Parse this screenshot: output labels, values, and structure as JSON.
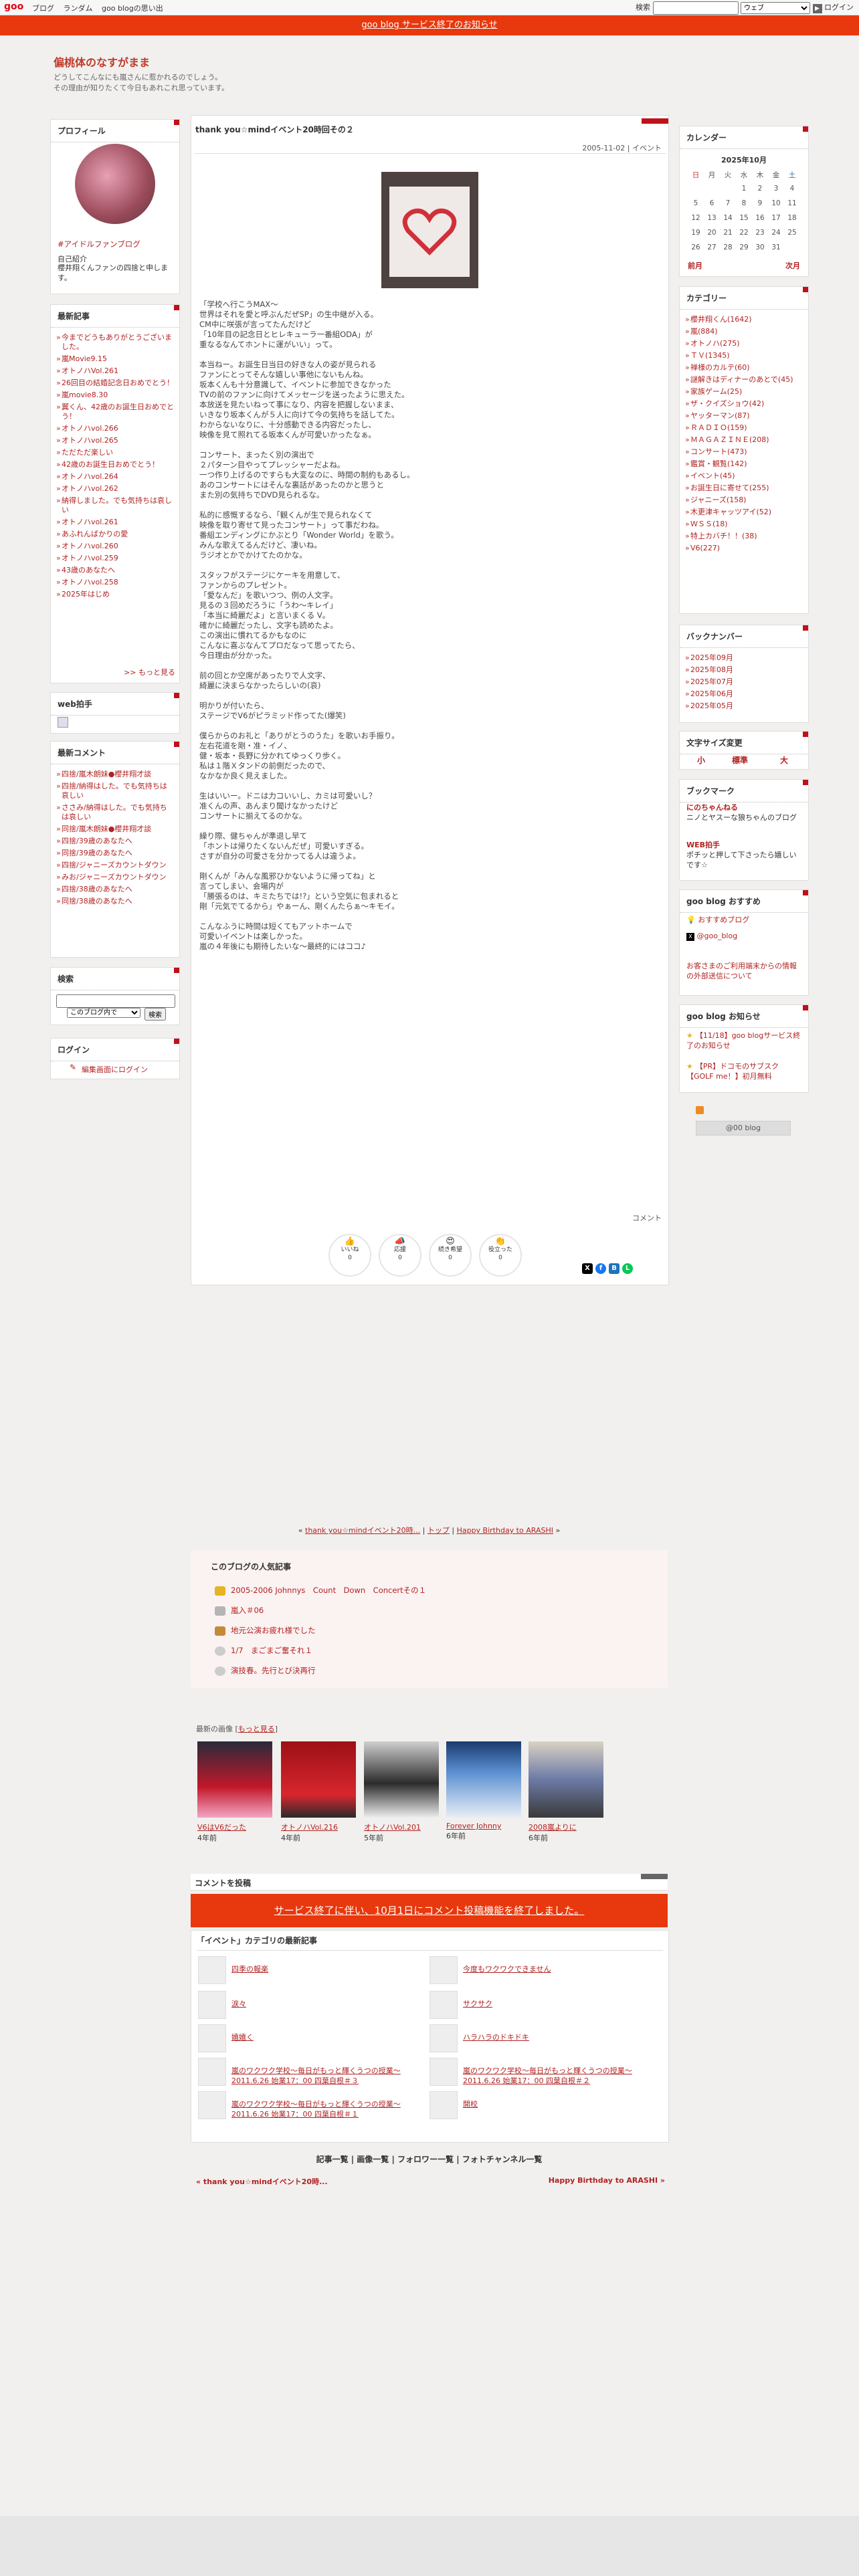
{
  "topbar": {
    "logo": "goo",
    "nav": [
      "ブログ",
      "ランダム",
      "goo blogの思い出"
    ],
    "search_label": "検索",
    "search_scope": "ウェブ",
    "login": "ログイン"
  },
  "notice": "goo blog サービス終了のお知らせ",
  "blog": {
    "title": "偏桃体のなすがまま",
    "desc1": "どうしてこんなにも嵐さんに惹かれるのでしょう。",
    "desc2": "その理由が知りたくて今日もあれこれ思っています。"
  },
  "profile": {
    "heading": "プロフィール",
    "tag": "#アイドルファンブログ",
    "intro_label": "自己紹介",
    "intro": "櫻井翔くんファンの四捨と申します。"
  },
  "recent_posts": {
    "heading": "最新記事",
    "items": [
      "今までどうもありがとうございました。",
      "嵐Movie9.15",
      "オトノハVol.261",
      "26回目の結婚記念日おめでとう！",
      "嵐movie8.30",
      "翼くん、42歳のお誕生日おめでとう！",
      "オトノハvol.266",
      "オトノハvol.265",
      "ただただ楽しい",
      "42歳のお誕生日おめでとう！",
      "オトノハvol.264",
      "オトノハvol.262",
      "納得しました。でも気持ちは哀しい",
      "オトノハvol.261",
      "あふれんばかりの愛",
      "オトノハvol.260",
      "オトノハvol.259",
      "43歳のあなたへ",
      "オトノハvol.258",
      "2025年はじめ"
    ],
    "more": ">> もっと見る"
  },
  "web_clap": {
    "heading": "web拍手"
  },
  "recent_comments": {
    "heading": "最新コメント",
    "items": [
      "四捨/嵐木朗妹●櫻井翔才談",
      "四捨/納得はした。でも気持ちは哀しい",
      "ささみ/納得はした。でも気持ちは哀しい",
      "同捨/嵐木朗妹●櫻井翔才談",
      "四捨/39歳のあなたへ",
      "同捨/39歳のあなたへ",
      "四捨/ジャニーズカウントダウン",
      "みお/ジャニーズカウントダウン",
      "四捨/38歳のあなたへ",
      "同捨/38歳のあなたへ"
    ]
  },
  "search": {
    "heading": "検索",
    "scope": "このブログ内で",
    "button": "検索"
  },
  "login_box": {
    "heading": "ログイン",
    "link": "編集画面にログイン"
  },
  "post": {
    "title": "thank you☆mindイベント20時回その２",
    "meta": "2005-11-02 | イベント",
    "paragraphs": [
      "「学校へ行こうMAX～\n世界はそれを愛と呼ぶんだぜSP」の生中継が入る。\nCM中に咲張が言ってたんだけど\n「10年目の記念日とヒレキューラ一番組ODA」が\n重なるなんてホントに運がいい」って。",
      "本当ねー。お誕生日当日の好きな人の姿が見られる\nファンにとってそんな嬉しい事他にないもんね。\n坂本くんも十分意識して、イベントに参加できなかった\nTVの前のファンに向けてメッセージを送ったように思えた。\n本放送を見たいねって事になり、内容を把握しないまま、\nいきなり坂本くんが５人に向けて今の気持ちを話してた。\nわからないなりに、十分感動できる内容だったし、\n映像を見て照れてる坂本くんが可愛いかったなぁ。",
      "コンサート、まったく別の演出で\n２パターン目やってプレッシャーだよね。\n一つ作り上げるのですらも大変なのに、時間の制約もあるし。\nあのコンサートにはそんな裏話があったのかと思うと\nまた別の気持ちでDVD見られるな。",
      "私的に感慨するなら、「観くんが生で見られなくて\n映像を取り寄せて見ったコンサート」って事だわね。\n番組エンディングにかぶとり「Wonder World」を歌う。\nみんな歌えてるんだけど、凄いね。\nラジオとかでかけてたのかな。",
      "スタッフがステージにケーキを用意して、\nファンからのプレゼント。\n「愛なんだ」を歌いつつ、例の人文字。\n見るの３回めだろうに「うわ～キレイ」\n「本当に綺麗だよ」と言いまくる V。\n確かに綺麗だったし、文字も読めたよ。\nこの演出に慣れてるかもなのに\nこんなに喜ぶなんてプロだなって思ってたら、\n今日理由が分かった。",
      "前の回とか空席があったりで人文字、\n綺麗に決まらなかったらしいの(哀)",
      "明かりが付いたら、\nステージでV6がピラミッド作ってた(爆笑)",
      "僕らからのお礼と「ありがとうのうた」を歌いお手振り。\n左右花道を剛・准・イノ、\n健・坂本・長野に分かれてゆっくり歩く。\n私は１階Ｘタンドの前側だったので、\nなかなか良く見えました。",
      "生はいいー。ドニは力コいいし、カミは可愛いし？\n准くんの声、あんまり聞けなかったけど\nコンサートに揃えてるのかな。",
      "繰り際、健ちゃんが準退し早て\n「ホントは帰りたくないんだぜ」可愛いすぎる。\nさすが自分の可愛さを分かってる人は違うよ。",
      "剛くんが「みんな風邪ひかないように帰ってね」と\n言ってしまい、会場内が\n「勝張るのは、キミたちでは!?」という空気に包まれると\n剛「元気でてるから」やぁーん、剛くんたらぁ～キモイ。",
      "こんなふうに時間は短くてもアットホームで\n可愛いイベントは楽しかった。\n嵐の４年後にも期待したいな～最終的にはココ♪"
    ],
    "comment_link": "コメント",
    "reactions": [
      {
        "label": "いいね",
        "count": "0"
      },
      {
        "label": "応援",
        "count": "0"
      },
      {
        "label": "続き希望",
        "count": "0"
      },
      {
        "label": "役立った",
        "count": "0"
      }
    ]
  },
  "pagenav": {
    "prev": "thank you☆mindイベント20時...",
    "top": "トップ",
    "next": "Happy Birthday to ARASHI"
  },
  "popular": {
    "heading": "このブログの人気記事",
    "items": [
      "2005-2006 Johnnys　Count　Down　Concertその１",
      "嵐入＃06",
      "地元公演お疲れ様でした",
      "1/7　まごまご奮それ１",
      "演技春。先行とび決再行"
    ]
  },
  "recent_images": {
    "label": "最新の画像",
    "more": "もっと見る",
    "items": [
      {
        "caption": "V6はV6だった",
        "age": "4年前"
      },
      {
        "caption": "オトノハVol.216",
        "age": "4年前"
      },
      {
        "caption": "オトノハVol.201",
        "age": "5年前"
      },
      {
        "caption": "Forever Johnny",
        "age": "6年前"
      },
      {
        "caption": "2008嵐よりに",
        "age": "6年前"
      }
    ]
  },
  "comment_section": {
    "heading": "コメントを投稿",
    "closed": "サービス終了に伴い、10月1日にコメント投稿機能を終了しました。"
  },
  "category_recent": {
    "heading": "「イベント」カテゴリの最新記事",
    "items": [
      "四季の報楽",
      "今度もワクワクできません",
      "涙々",
      "サクサク",
      "嬉嬉く",
      "ハラハラのドキドキ",
      "嵐のワクワク学校～毎日がもっと輝くうつの授業～2011.6.26 始業17：00 四葉自根＃３",
      "嵐のワクワク学校～毎日がもっと輝くうつの授業～2011.6.26 始業17：00 四葉自根＃２",
      "嵐のワクワク学校～毎日がもっと輝くうつの授業～2011.6.26 始業17：00 四葉自根＃１",
      "開校"
    ]
  },
  "footer": {
    "links": "記事一覧 | 画像一覧 | フォロワー一覧 | フォトチャンネル一覧",
    "prev": "« thank you☆mindイベント20時...",
    "next": "Happy Birthday to ARASHI »"
  },
  "calendar": {
    "heading": "カレンダー",
    "month": "2025年10月",
    "weekdays": [
      "日",
      "月",
      "火",
      "水",
      "木",
      "金",
      "土"
    ],
    "weeks": [
      [
        "",
        "",
        "",
        "1",
        "2",
        "3",
        "4"
      ],
      [
        "5",
        "6",
        "7",
        "8",
        "9",
        "10",
        "11"
      ],
      [
        "12",
        "13",
        "14",
        "15",
        "16",
        "17",
        "18"
      ],
      [
        "19",
        "20",
        "21",
        "22",
        "23",
        "24",
        "25"
      ],
      [
        "26",
        "27",
        "28",
        "29",
        "30",
        "31",
        ""
      ]
    ],
    "prev": "前月",
    "next": "次月"
  },
  "categories": {
    "heading": "カテゴリー",
    "items": [
      "櫻井翔くん(1642)",
      "嵐(884)",
      "オトノハ(275)",
      "ＴＶ(1345)",
      "禅様のカルテ(60)",
      "謎解きはディナーのあとで(45)",
      "家族ゲーム(25)",
      "ザ・クイズショウ(42)",
      "ヤッターマン(87)",
      "ＲＡＤＩＯ(159)",
      "ＭＡＧＡＺＩＮＥ(208)",
      "コンサート(473)",
      "鑑賞・観覧(142)",
      "イベント(45)",
      "お誕生日に寄せて(255)",
      "ジャニーズ(158)",
      "木更津キャッツアイ(52)",
      "ＷＳＳ(18)",
      "特上カバチ！！(38)",
      "V6(227)"
    ]
  },
  "backnumber": {
    "heading": "バックナンバー",
    "items": [
      "2025年09月",
      "2025年08月",
      "2025年07月",
      "2025年06月",
      "2025年05月"
    ]
  },
  "fontsize": {
    "heading": "文字サイズ変更",
    "small": "小",
    "normal": "標準",
    "large": "大"
  },
  "bookmark": {
    "heading": "ブックマーク",
    "items": [
      {
        "title": "にのちゃんねる",
        "desc": "ニノとヤスーな狼ちゃんのブログ"
      },
      {
        "title": "WEB拍手",
        "desc": "ポチッと押して下さったら嬉しいです☆"
      }
    ]
  },
  "goo_recommend": {
    "heading": "goo blog おすすめ",
    "items": [
      "おすすめブログ",
      "@goo_blog"
    ],
    "notice": "お客さまのご利用端末からの情報の外部送信について"
  },
  "goo_news": {
    "heading": "goo blog お知らせ",
    "items": [
      "【11/18】goo blogサービス終了のお知らせ",
      "【PR】ドコモのサブスク【GOLF me！】初月無料"
    ]
  },
  "goo_badge": "@00 blog",
  "colors": {
    "accent": "#e8380d",
    "link": "#b22222",
    "marker": "#c0101a"
  }
}
